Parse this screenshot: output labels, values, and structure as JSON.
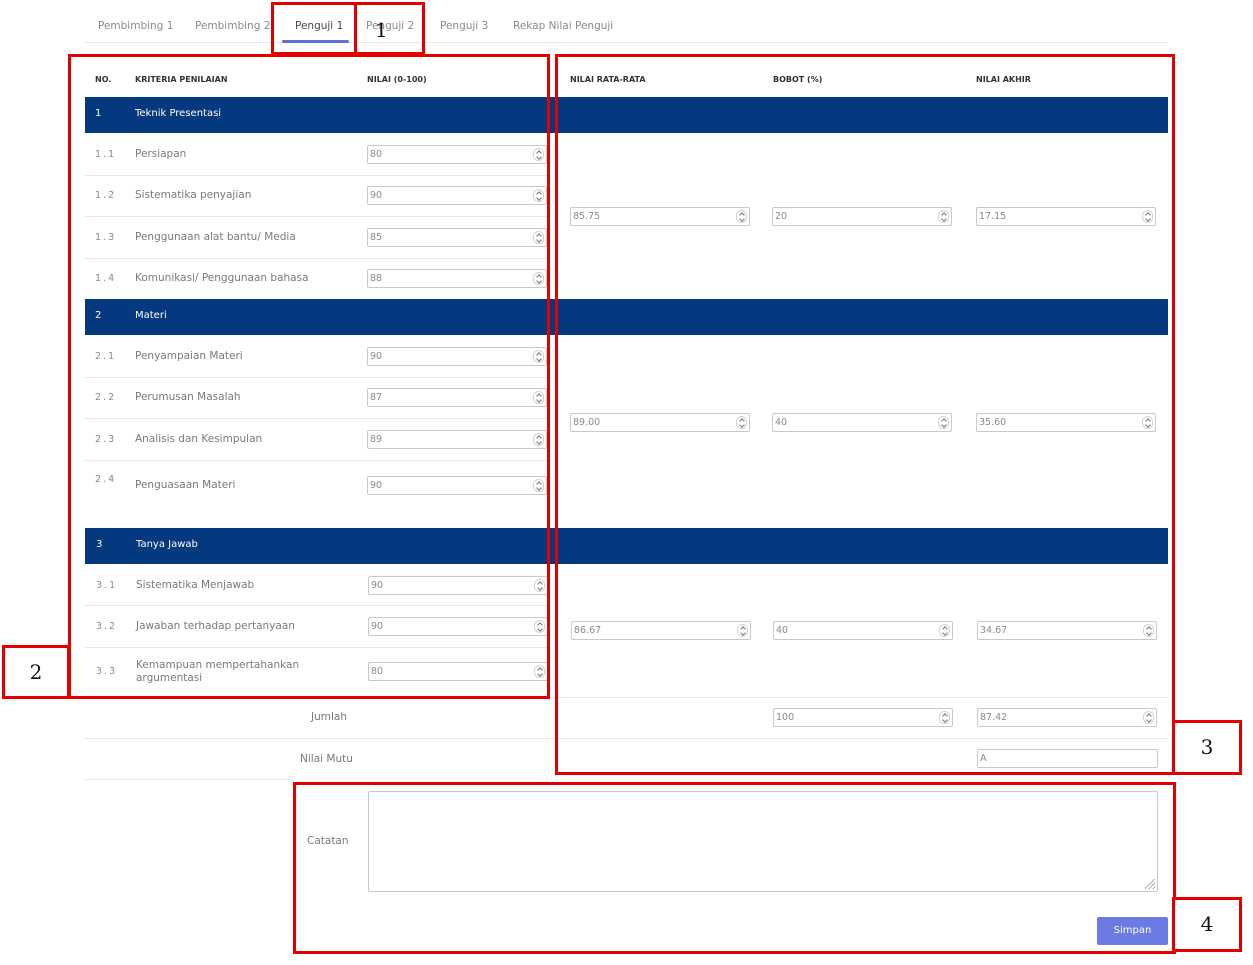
{
  "tabs": [
    {
      "label": "Pembimbing 1"
    },
    {
      "label": "Pembimbing 2"
    },
    {
      "label": "Penguji 1"
    },
    {
      "label": "Penguji 2"
    },
    {
      "label": "Penguji 3"
    },
    {
      "label": "Rekap Nilai Penguji"
    }
  ],
  "active_tab": "Penguji 1",
  "columns": [
    "NO.",
    "KRITERIA PENILAIAN",
    "NILAI (0-100)",
    "NILAI RATA-RATA",
    "BOBOT (%)",
    "NILAI AKHIR"
  ],
  "sections": [
    {
      "no": "1",
      "title": "Teknik Presentasi",
      "average": "85.75",
      "weight": "20",
      "final": "17.15",
      "items": [
        {
          "no": "1.1",
          "label": "Persiapan",
          "score": "80"
        },
        {
          "no": "1.2",
          "label": "Sistematika penyajian",
          "score": "90"
        },
        {
          "no": "1.3",
          "label": "Penggunaan alat bantu/ Media",
          "score": "85"
        },
        {
          "no": "1.4",
          "label": "Komunikasi/ Penggunaan bahasa",
          "score": "88"
        }
      ]
    },
    {
      "no": "2",
      "title": "Materi",
      "average": "89.00",
      "weight": "40",
      "final": "35.60",
      "items": [
        {
          "no": "2.1",
          "label": "Penyampaian Materi",
          "score": "90"
        },
        {
          "no": "2.2",
          "label": "Perumusan Masalah",
          "score": "87"
        },
        {
          "no": "2.3",
          "label": "Analisis dan Kesimpulan",
          "score": "89"
        },
        {
          "no": "2.4",
          "label": "Penguasaan Materi",
          "score": "90"
        }
      ]
    },
    {
      "no": "3",
      "title": "Tanya Jawab",
      "average": "86.67",
      "weight": "40",
      "final": "34.67",
      "items": [
        {
          "no": "3.1",
          "label": "Sistematika Menjawab",
          "score": "90"
        },
        {
          "no": "3.2",
          "label": "Jawaban terhadap pertanyaan",
          "score": "90"
        },
        {
          "no": "3.3",
          "label": "Kemampuan mempertahankan argumentasi",
          "score": "80"
        }
      ]
    }
  ],
  "summary": {
    "total_label": "Jumlah",
    "total_weight": "100",
    "total_final": "87.42",
    "grade_label": "Nilai Mutu",
    "grade": "A"
  },
  "notes": {
    "label": "Catatan",
    "value": ""
  },
  "save_label": "Simpan",
  "annotations": [
    "1",
    "2",
    "3",
    "4"
  ],
  "colors": {
    "section_bar": "#04397f",
    "accent": "#5b6fd6",
    "button": "#6c7be3",
    "annotation": "#e50000"
  }
}
